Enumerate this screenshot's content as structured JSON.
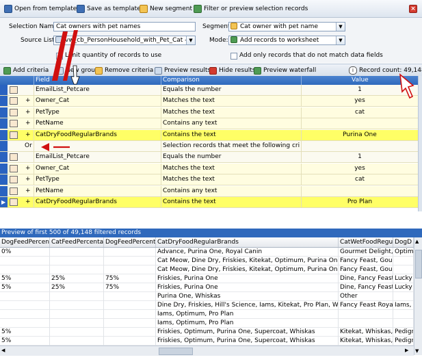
{
  "toolbar": {
    "open_template": "Open from template",
    "save_template": "Save as template",
    "new_segment": "New segment",
    "filter_preview": "Filter or preview selection records"
  },
  "form": {
    "selection_name_label": "Selection Name:",
    "selection_name_value": "Cat owners with pet names",
    "segment_label": "Segment:",
    "segment_value": "Cat owner with pet name",
    "source_list_label": "Source List:",
    "source_list_value": "vw_cb_PersonHousehold_with_Pet_Cat -...",
    "mode_label": "Mode:",
    "mode_value": "Add records to worksheet",
    "limit_quantity": "Limit quantity of records to use",
    "add_only": "Add only records that do not match data fields"
  },
  "toolbar2": {
    "add_criteria": "Add criteria",
    "new_group": "New group",
    "remove_criteria": "Remove criteria",
    "preview_results": "Preview results",
    "hide_results": "Hide results",
    "preview_waterfall": "Preview waterfall",
    "record_count": "Record count: 49,148"
  },
  "grid": {
    "headers": {
      "field": "Field",
      "comparison": "Comparison",
      "value": "Value"
    },
    "rows": [
      {
        "plus": "",
        "field": "EmailList_Petcare",
        "comparison": "Equals the number",
        "value": "1"
      },
      {
        "plus": "+",
        "field": "Owner_Cat",
        "comparison": "Matches the text",
        "value": "yes"
      },
      {
        "plus": "+",
        "field": "PetType",
        "comparison": "Matches the text",
        "value": "cat"
      },
      {
        "plus": "+",
        "field": "PetName",
        "comparison": "Contains any text",
        "value": ""
      },
      {
        "plus": "+",
        "field": "CatDryFoodRegularBrands",
        "comparison": "Contains the text",
        "value": "Purina One"
      },
      {
        "plus": "Or",
        "field": "",
        "comparison": "Selection records that meet the following criteria",
        "value": ""
      },
      {
        "plus": "",
        "field": "EmailList_Petcare",
        "comparison": "Equals the number",
        "value": "1"
      },
      {
        "plus": "+",
        "field": "Owner_Cat",
        "comparison": "Matches the text",
        "value": "yes"
      },
      {
        "plus": "+",
        "field": "PetType",
        "comparison": "Matches the text",
        "value": "cat"
      },
      {
        "plus": "+",
        "field": "PetName",
        "comparison": "Contains any text",
        "value": ""
      },
      {
        "plus": "+",
        "field": "CatDryFoodRegularBrands",
        "comparison": "Contains the text",
        "value": "Pro Plan"
      }
    ]
  },
  "preview": {
    "title": "Preview of first 500 of 49,148 filtered records",
    "columns": [
      "DogFeedPercenta",
      "CatFeedPercentag",
      "DogFeedPercenta",
      "CatDryFoodRegularBrands",
      "CatWetFoodRegul",
      "DogD"
    ],
    "rows": [
      [
        "0%",
        "",
        "",
        "Advance, Purina One, Royal Canin",
        "Gourmet Delight,",
        "Optim"
      ],
      [
        "",
        "",
        "",
        "Cat Meow, Dine Dry, Friskies, Kitekat, Optimum, Purina One, Whisk",
        "Fancy Feast, Gour",
        ""
      ],
      [
        "",
        "",
        "",
        "Cat Meow, Dine Dry, Friskies, Kitekat, Optimum, Purina One, Whisk",
        "Fancy Feast, Gour",
        ""
      ],
      [
        "5%",
        "25%",
        "75%",
        "Friskies, Purina One",
        "Dine, Fancy Feast,",
        "Lucky"
      ],
      [
        "5%",
        "25%",
        "75%",
        "Friskies, Purina One",
        "Dine, Fancy Feast,",
        "Lucky"
      ],
      [
        "",
        "",
        "",
        "Purina One, Whiskas",
        "Other",
        ""
      ],
      [
        "",
        "",
        "",
        "Dine Dry, Friskies, Hill's Science, Iams, Kitekat, Pro Plan, Whiskas",
        "Fancy Feast Royal",
        "Iams,"
      ],
      [
        "",
        "",
        "",
        "Iams, Optimum, Pro Plan",
        "",
        ""
      ],
      [
        "",
        "",
        "",
        "Iams, Optimum, Pro Plan",
        "",
        ""
      ],
      [
        "5%",
        "",
        "",
        "Friskies, Optimum, Purina One, Supercoat, Whiskas",
        "Kitekat, Whiskas,",
        "Pedigr"
      ],
      [
        "5%",
        "",
        "",
        "Friskies, Optimum, Purina One, Supercoat, Whiskas",
        "Kitekat, Whiskas,",
        "Pedigr"
      ]
    ]
  },
  "colors": {
    "yellow_row": "#ffff66",
    "light_row": "#fffde0",
    "header_blue": "#2f69bc",
    "annotation_red": "#d01010"
  }
}
